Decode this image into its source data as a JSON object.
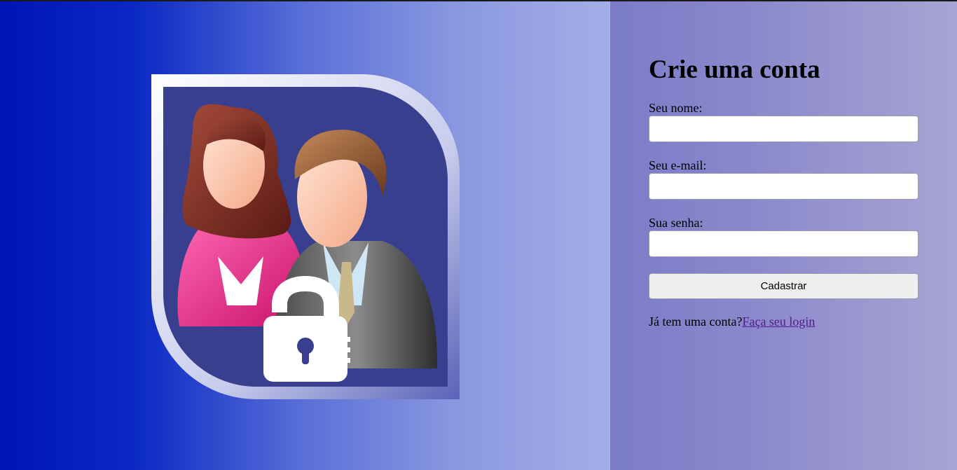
{
  "form": {
    "title": "Crie uma conta",
    "name_label": "Seu nome:",
    "name_value": "",
    "email_label": "Seu e-mail:",
    "email_value": "",
    "password_label": "Sua senha:",
    "password_value": "",
    "submit_label": "Cadastrar",
    "login_prompt": "Já tem uma conta?",
    "login_link": "Faça seu login"
  },
  "illustration": {
    "icon": "users-lock-icon"
  },
  "colors": {
    "left_gradient_start": "#0014b8",
    "left_gradient_end": "#a4aee6",
    "right_gradient_start": "#7b7cc8",
    "right_gradient_end": "#a8a4d4",
    "link": "#551a8b"
  }
}
